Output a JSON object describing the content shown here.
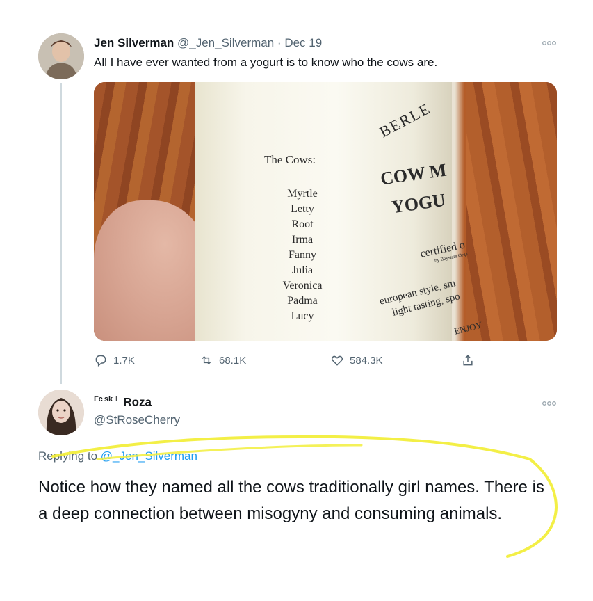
{
  "tweet1": {
    "author_name": "Jen Silverman",
    "handle": "@_Jen_Silverman",
    "separator": "·",
    "date": "Dec 19",
    "text": "All I have ever wanted from a yogurt is to know who the cows are.",
    "more_icon": "more-dots-icon",
    "image": {
      "cows_title": "The Cows:",
      "cow_names": [
        "Myrtle",
        "Letty",
        "Root",
        "Irma",
        "Fanny",
        "Julia",
        "Veronica",
        "Padma",
        "Lucy"
      ],
      "brand": "BERLE",
      "product_line1": "COW M",
      "product_line2": "YOGU",
      "certified": "certified o",
      "small_print": "by Baystate Orga",
      "desc_line1": "european style, sm",
      "desc_line2": "light tasting, spo",
      "enjoy": "ENJOY"
    },
    "actions": {
      "replies": "1.7K",
      "retweets": "68.1K",
      "likes": "584.3K"
    }
  },
  "tweet2": {
    "badge": "Γc sk ˩",
    "author_name": "Roza",
    "handle": "@StRoseCherry",
    "replying_label": "Replying to",
    "replying_to": "@_Jen_Silverman",
    "text": "Notice how they named all the cows traditionally girl names. There is a deep connection between misogyny and consuming animals."
  },
  "colors": {
    "highlight": "#f2ee3c",
    "link": "#1d9bf0",
    "meta": "#536471"
  }
}
